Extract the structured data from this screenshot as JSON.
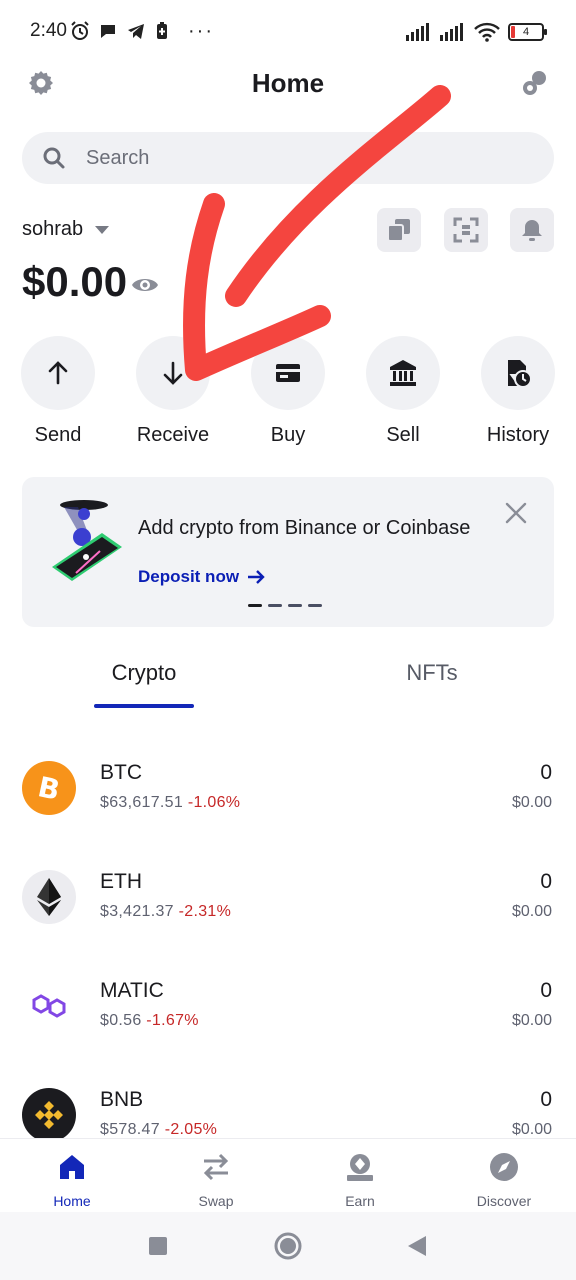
{
  "status_bar": {
    "time": "2:40",
    "dots": "···",
    "battery": "4"
  },
  "header": {
    "title": "Home",
    "settings_icon": "gear-icon",
    "right_icon": "connections-icon"
  },
  "search": {
    "placeholder": "Search"
  },
  "wallet": {
    "name": "sohrab",
    "balance": "$0.00"
  },
  "quick_actions": [
    {
      "label": "Send",
      "icon": "arrow-up-icon"
    },
    {
      "label": "Receive",
      "icon": "arrow-down-icon"
    },
    {
      "label": "Buy",
      "icon": "card-icon"
    },
    {
      "label": "Sell",
      "icon": "bank-icon"
    },
    {
      "label": "History",
      "icon": "history-icon"
    }
  ],
  "promo": {
    "title": "Add crypto from Binance or Coinbase",
    "link": "Deposit now"
  },
  "tabs": [
    {
      "label": "Crypto",
      "active": true
    },
    {
      "label": "NFTs",
      "active": false
    }
  ],
  "assets": [
    {
      "symbol": "BTC",
      "price": "$63,617.51",
      "change": "-1.06%",
      "amount": "0",
      "value": "$0.00",
      "color": "#f7931a"
    },
    {
      "symbol": "ETH",
      "price": "$3,421.37",
      "change": "-2.31%",
      "amount": "0",
      "value": "$0.00",
      "color": "#ececf0"
    },
    {
      "symbol": "MATIC",
      "price": "$0.56",
      "change": "-1.67%",
      "amount": "0",
      "value": "$0.00",
      "color": "#8247e5"
    },
    {
      "symbol": "BNB",
      "price": "$578.47",
      "change": "-2.05%",
      "amount": "0",
      "value": "$0.00",
      "color": "#f3ba2f"
    }
  ],
  "bottom_nav": [
    {
      "label": "Home",
      "icon": "home-icon",
      "active": true
    },
    {
      "label": "Swap",
      "icon": "swap-icon",
      "active": false
    },
    {
      "label": "Earn",
      "icon": "earn-icon",
      "active": false
    },
    {
      "label": "Discover",
      "icon": "compass-icon",
      "active": false
    }
  ],
  "colors": {
    "accent": "#1327b8",
    "negative": "#c62828",
    "annotation": "#f4453f"
  }
}
